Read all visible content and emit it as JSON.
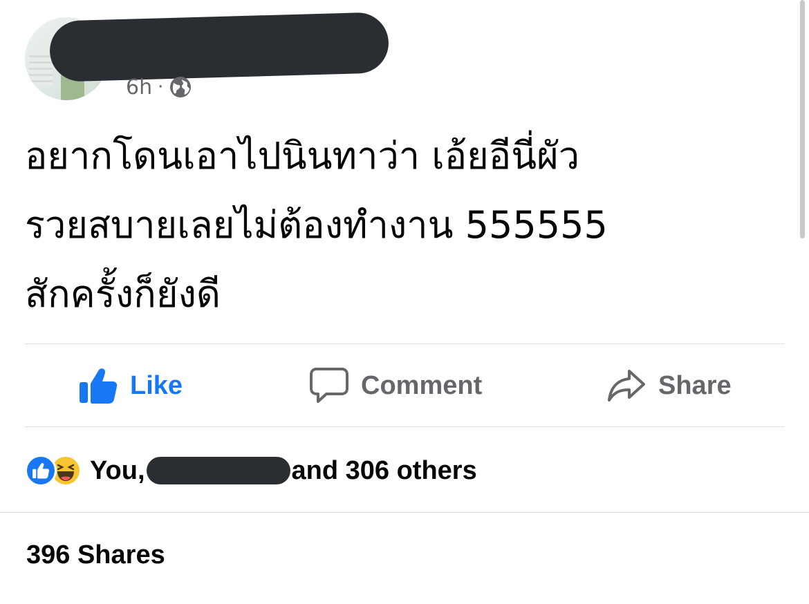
{
  "post": {
    "time": "6h",
    "separator": "·",
    "privacy_icon": "globe-icon",
    "text": "อยากโดนเอาไปนินทาว่า เอ้ยอีนี่ผัว\nรวยสบายเลยไม่ต้องทำงาน 555555\nสักครั้งก็ยังดี"
  },
  "actions": {
    "like_label": "Like",
    "comment_label": "Comment",
    "share_label": "Share"
  },
  "reactions": {
    "prefix": "You,",
    "suffix": "and 306 others",
    "icons": [
      "like-reaction-icon",
      "haha-reaction-icon"
    ]
  },
  "shares_text": "396 Shares",
  "colors": {
    "accent": "#1877f2",
    "secondary_text": "#65676b",
    "primary_text": "#050505",
    "haha": "#f7c531"
  }
}
